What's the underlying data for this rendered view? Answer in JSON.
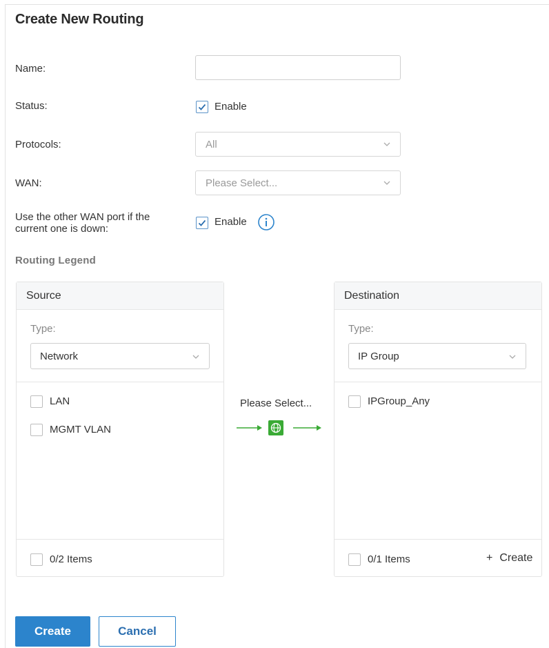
{
  "title": "Create New Routing",
  "fields": {
    "name_label": "Name:",
    "name_value": "",
    "status_label": "Status:",
    "status_enable_label": "Enable",
    "status_checked": true,
    "protocols_label": "Protocols:",
    "protocols_value": "All",
    "wan_label": "WAN:",
    "wan_placeholder": "Please Select...",
    "failover_label_line1": "Use the other WAN port if the",
    "failover_label_line2": "current one is down:",
    "failover_enable_label": "Enable",
    "failover_checked": true
  },
  "legend": {
    "title": "Routing  Legend",
    "source": {
      "header": "Source",
      "type_label": "Type:",
      "type_value": "Network",
      "items": [
        {
          "label": "LAN",
          "checked": false
        },
        {
          "label": "MGMT VLAN",
          "checked": false
        }
      ],
      "footer": "0/2 Items"
    },
    "middle_text": "Please Select...",
    "destination": {
      "header": "Destination",
      "type_label": "Type:",
      "type_value": "IP Group",
      "items": [
        {
          "label": "IPGroup_Any",
          "checked": false
        }
      ],
      "footer": "0/1 Items",
      "create_label": "Create"
    }
  },
  "buttons": {
    "create": "Create",
    "cancel": "Cancel"
  },
  "colors": {
    "accent": "#2c84cc",
    "arrow_green": "#3aaa35",
    "checkbox_border": "#5a93c8"
  },
  "icons": {
    "info": "info-circle-icon",
    "globe": "globe-icon",
    "chevron": "chevron-down-icon",
    "plus": "plus-icon"
  }
}
